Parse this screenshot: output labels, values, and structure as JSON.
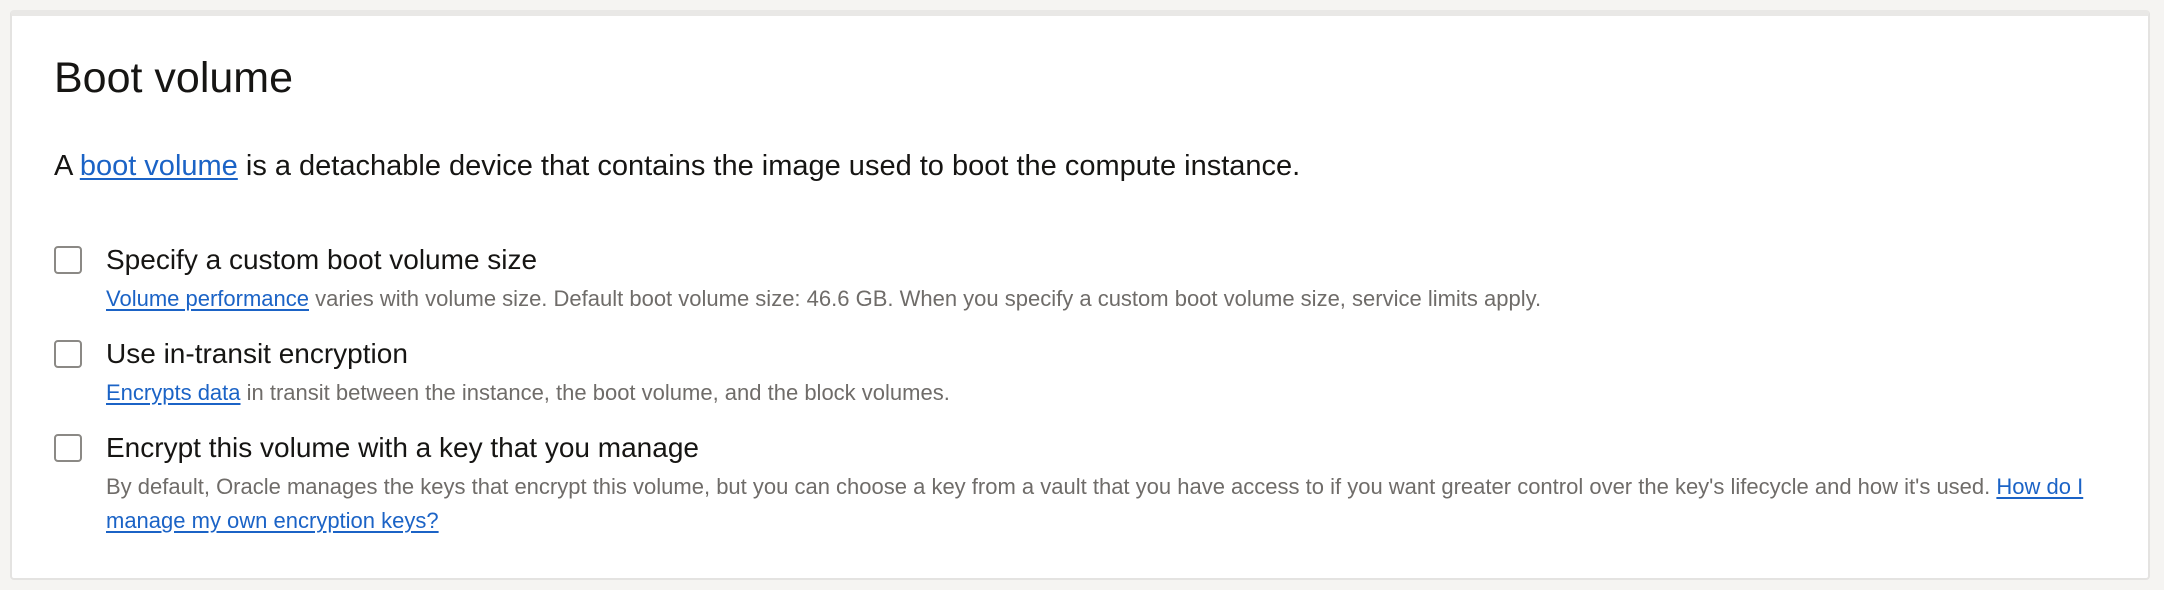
{
  "section": {
    "title": "Boot volume",
    "intro": {
      "prefix": "A ",
      "link": "boot volume",
      "suffix": " is a detachable device that contains the image used to boot the compute instance."
    }
  },
  "options": [
    {
      "label": "Specify a custom boot volume size",
      "checked": false,
      "desc_link": "Volume performance",
      "desc_text": " varies with volume size. Default boot volume size: 46.6 GB. When you specify a custom boot volume size, service limits apply."
    },
    {
      "label": "Use in-transit encryption",
      "checked": false,
      "desc_link": "Encrypts data",
      "desc_text": " in transit between the instance, the boot volume, and the block volumes."
    },
    {
      "label": "Encrypt this volume with a key that you manage",
      "checked": false,
      "desc_text": "By default, Oracle manages the keys that encrypt this volume, but you can choose a key from a vault that you have access to if you want greater control over the key's lifecycle and how it's used. ",
      "desc_link": "How do I manage my own encryption keys?"
    }
  ],
  "colors": {
    "link": "#1b63c6",
    "text": "#161513",
    "muted": "#6f6c69",
    "checkbox_border": "#8b8985"
  }
}
